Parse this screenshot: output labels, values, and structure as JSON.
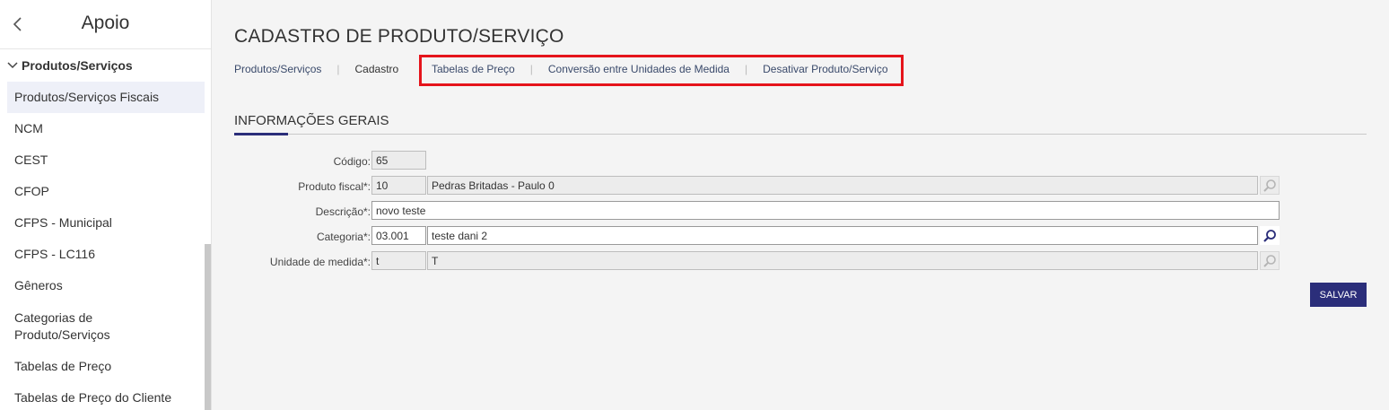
{
  "sidebar": {
    "title": "Apoio",
    "section": "Produtos/Serviços",
    "items": [
      {
        "label": "Produtos/Serviços Fiscais"
      },
      {
        "label": "NCM"
      },
      {
        "label": "CEST"
      },
      {
        "label": "CFOP"
      },
      {
        "label": "CFPS - Municipal"
      },
      {
        "label": "CFPS - LC116"
      },
      {
        "label": "Gêneros"
      },
      {
        "label": "Categorias de Produto/Serviços"
      },
      {
        "label": "Tabelas de Preço"
      },
      {
        "label": "Tabelas de Preço do Cliente"
      }
    ]
  },
  "page": {
    "title": "CADASTRO DE PRODUTO/SERVIÇO",
    "breadcrumb": {
      "parent": "Produtos/Serviços",
      "current": "Cadastro"
    },
    "tabs": [
      "Tabelas de Preço",
      "Conversão entre Unidades de Medida",
      "Desativar Produto/Serviço"
    ]
  },
  "form": {
    "section_title": "INFORMAÇÕES GERAIS",
    "codigo": {
      "label": "Código:",
      "value": "65"
    },
    "produto_fiscal": {
      "label": "Produto fiscal*:",
      "code": "10",
      "name": "Pedras Britadas - Paulo 0"
    },
    "descricao": {
      "label": "Descrição*:",
      "value": "novo teste"
    },
    "categoria": {
      "label": "Categoria*:",
      "code": "03.001",
      "name": "teste dani 2"
    },
    "unidade": {
      "label": "Unidade de medida*:",
      "code": "t",
      "name": "T"
    },
    "save_label": "SALVAR"
  },
  "colors": {
    "accent": "#2b2e7a",
    "highlight_box": "#e5141b"
  }
}
